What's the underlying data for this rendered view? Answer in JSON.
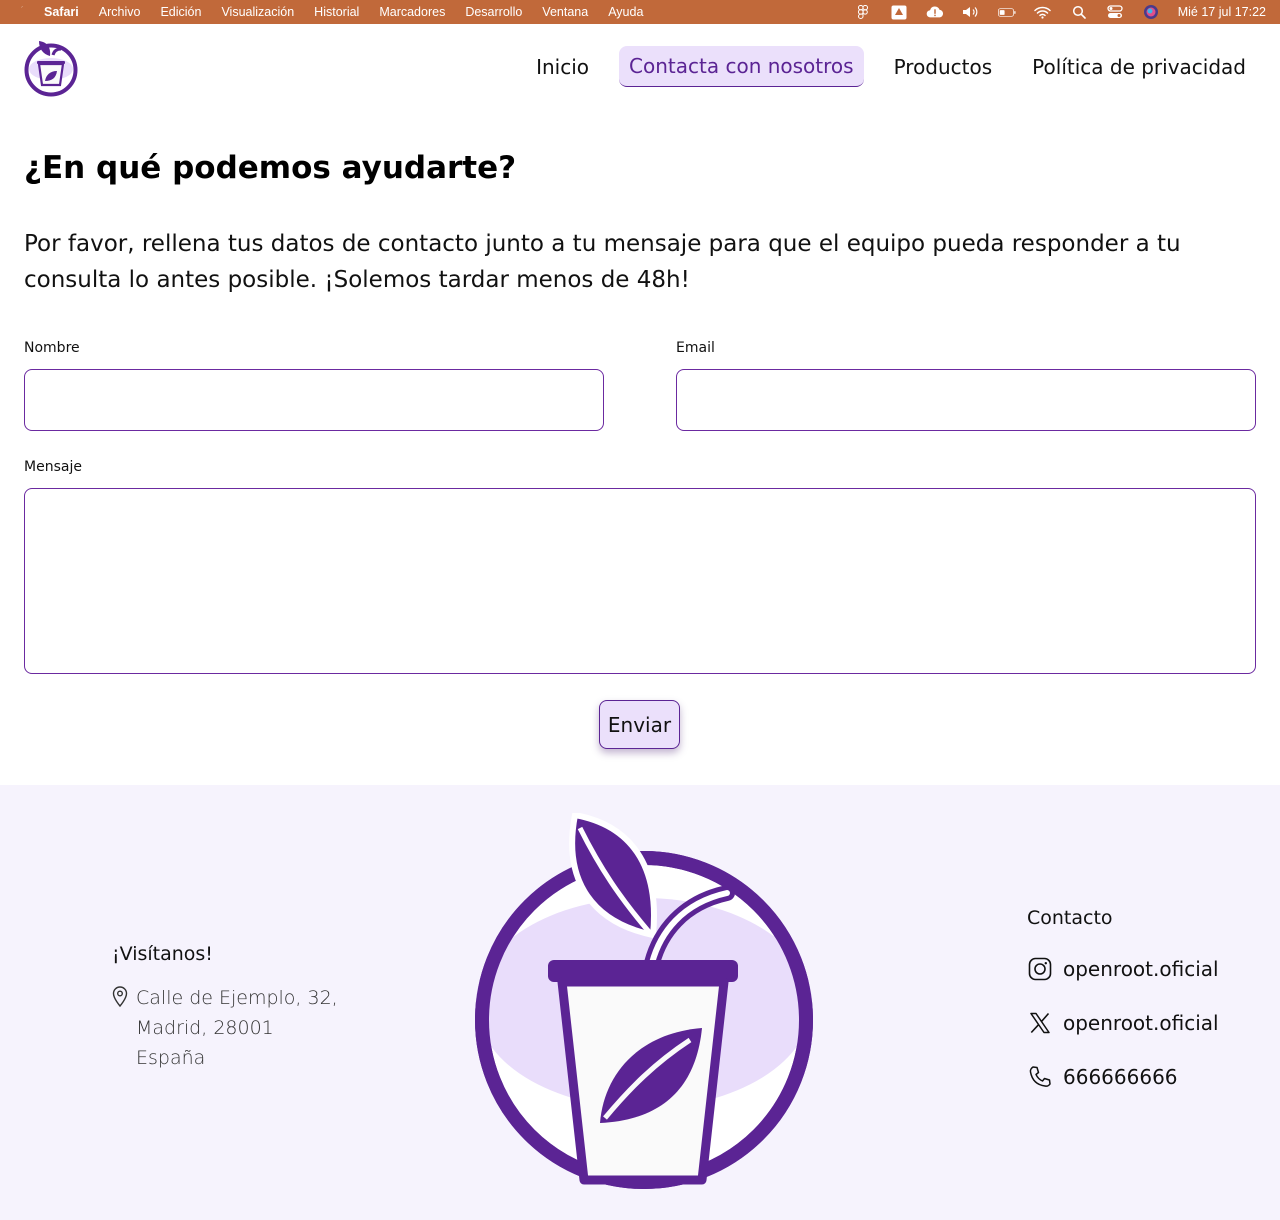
{
  "menubar": {
    "items": [
      "Safari",
      "Archivo",
      "Edición",
      "Visualización",
      "Historial",
      "Marcadores",
      "Desarrollo",
      "Ventana",
      "Ayuda"
    ],
    "clock": "Mié 17 jul  17:22",
    "status_icons": [
      "figma-icon",
      "drive-icon",
      "cloud-alert-icon",
      "volume-icon",
      "battery-icon",
      "wifi-icon",
      "search-icon",
      "control-center-icon",
      "siri-icon"
    ],
    "color": "#c1693a"
  },
  "nav": {
    "items": [
      {
        "label": "Inicio"
      },
      {
        "label": "Contacta con nosotros",
        "active": true
      },
      {
        "label": "Productos"
      },
      {
        "label": "Política de privacidad"
      }
    ]
  },
  "main": {
    "title": "¿En qué podemos ayudarte?",
    "intro": "Por favor, rellena tus datos de contacto junto a tu mensaje para que el equipo pueda responder a tu consulta lo antes posible. ¡Solemos tardar menos de 48h!"
  },
  "form": {
    "name_label": "Nombre",
    "name_value": "",
    "email_label": "Email",
    "email_value": "",
    "message_label": "Mensaje",
    "message_value": "",
    "submit_label": "Enviar"
  },
  "footer": {
    "visit_title": "¡Visítanos!",
    "address": [
      "Calle de Ejemplo, 32,",
      "Madrid, 28001",
      "España"
    ],
    "contact_title": "Contacto",
    "contacts": [
      {
        "icon": "instagram-icon",
        "text": "openroot.oficial"
      },
      {
        "icon": "x-icon",
        "text": "openroot.oficial"
      },
      {
        "icon": "phone-icon",
        "text": "666666666"
      }
    ]
  },
  "colors": {
    "brand_purple": "#5b2494",
    "accent_light": "#ebe0fb",
    "footer_bg": "#f6f3fd"
  }
}
